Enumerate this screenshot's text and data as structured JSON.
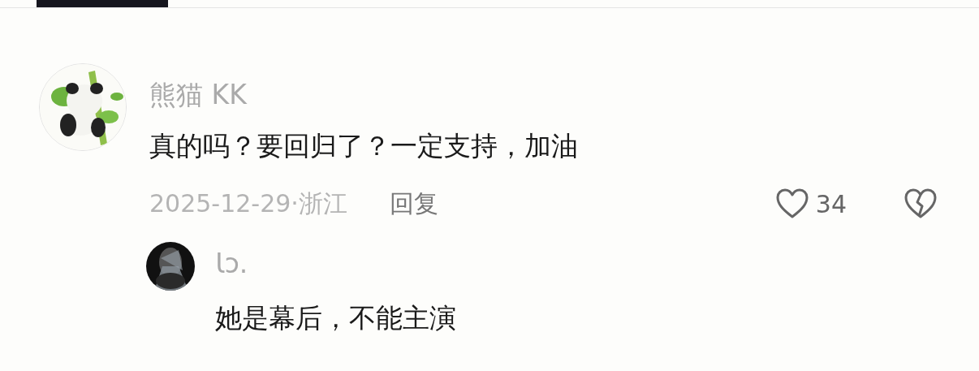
{
  "comments": [
    {
      "kind": "comment",
      "author": "熊猫 KK",
      "text": "真的吗？要回归了？一定支持，加油",
      "date": "2025-12-29·浙江",
      "reply_label": "回复",
      "likes": "34",
      "liked": false
    },
    {
      "kind": "reply",
      "author": "Ɩɔ.",
      "text": "她是幕后，不能主演"
    }
  ]
}
